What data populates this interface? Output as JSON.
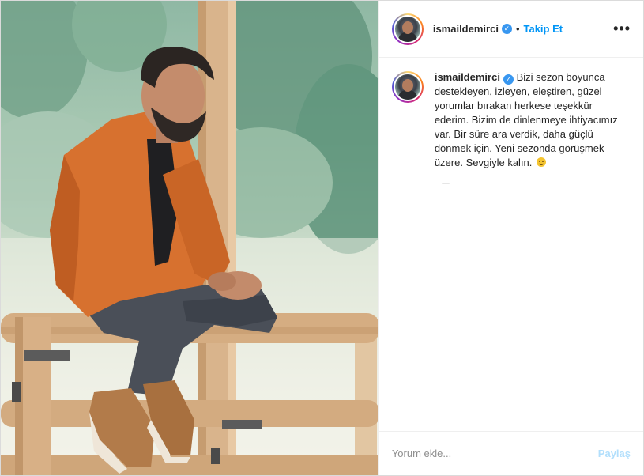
{
  "post": {
    "username": "ismaildemirci",
    "verified_icon": "verified-badge-icon",
    "separator": "•",
    "follow_label": "Takip Et",
    "more_icon": "•••",
    "caption": "Bizi sezon boyunca destekleyen, izleyen, eleştiren, güzel yorumlar bırakan herkese teşekkür ederim. Bizim de dinlenmeye ihtiyacımız var. Bir süre ara verdik, daha güçlü dönmek için. Yeni sezonda görüşmek üzere. Sevgiyle kalın.",
    "caption_emoji": "smiling-face-icon"
  },
  "comment": {
    "placeholder": "Yorum ekle...",
    "share_label": "Paylaş"
  },
  "colors": {
    "link_blue": "#0095f6",
    "share_disabled": "#b2dffc",
    "verified_blue": "#3897f0"
  }
}
